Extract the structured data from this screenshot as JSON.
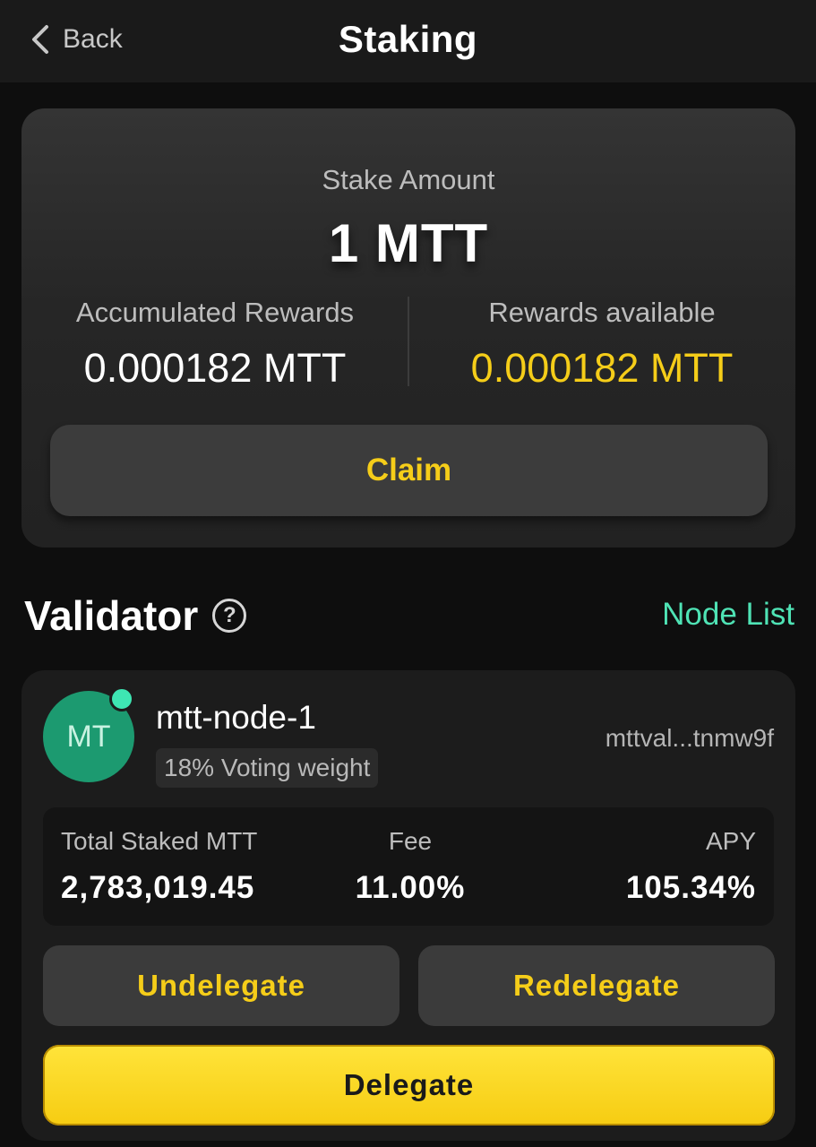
{
  "header": {
    "back_label": "Back",
    "title": "Staking"
  },
  "stake": {
    "label": "Stake Amount",
    "value": "1 MTT",
    "accumulated_label": "Accumulated Rewards",
    "accumulated_value": "0.000182 MTT",
    "available_label": "Rewards available",
    "available_value": "0.000182 MTT",
    "claim_label": "Claim"
  },
  "validator_section": {
    "title": "Validator",
    "help_icon": "question-circle-icon",
    "node_list_label": "Node List"
  },
  "validator": {
    "avatar_initials": "MT",
    "status": "online",
    "name": "mtt-node-1",
    "voting_weight": "18% Voting weight",
    "address": "mttval...tnmw9f",
    "stats": {
      "total_staked_label": "Total Staked MTT",
      "total_staked_value": "2,783,019.45",
      "fee_label": "Fee",
      "fee_value": "11.00%",
      "apy_label": "APY",
      "apy_value": "105.34%"
    },
    "undelegate_label": "Undelegate",
    "redelegate_label": "Redelegate",
    "delegate_label": "Delegate"
  },
  "colors": {
    "accent_yellow": "#f5cd19",
    "accent_green": "#4fe3b5",
    "avatar_green": "#1c9a70"
  }
}
